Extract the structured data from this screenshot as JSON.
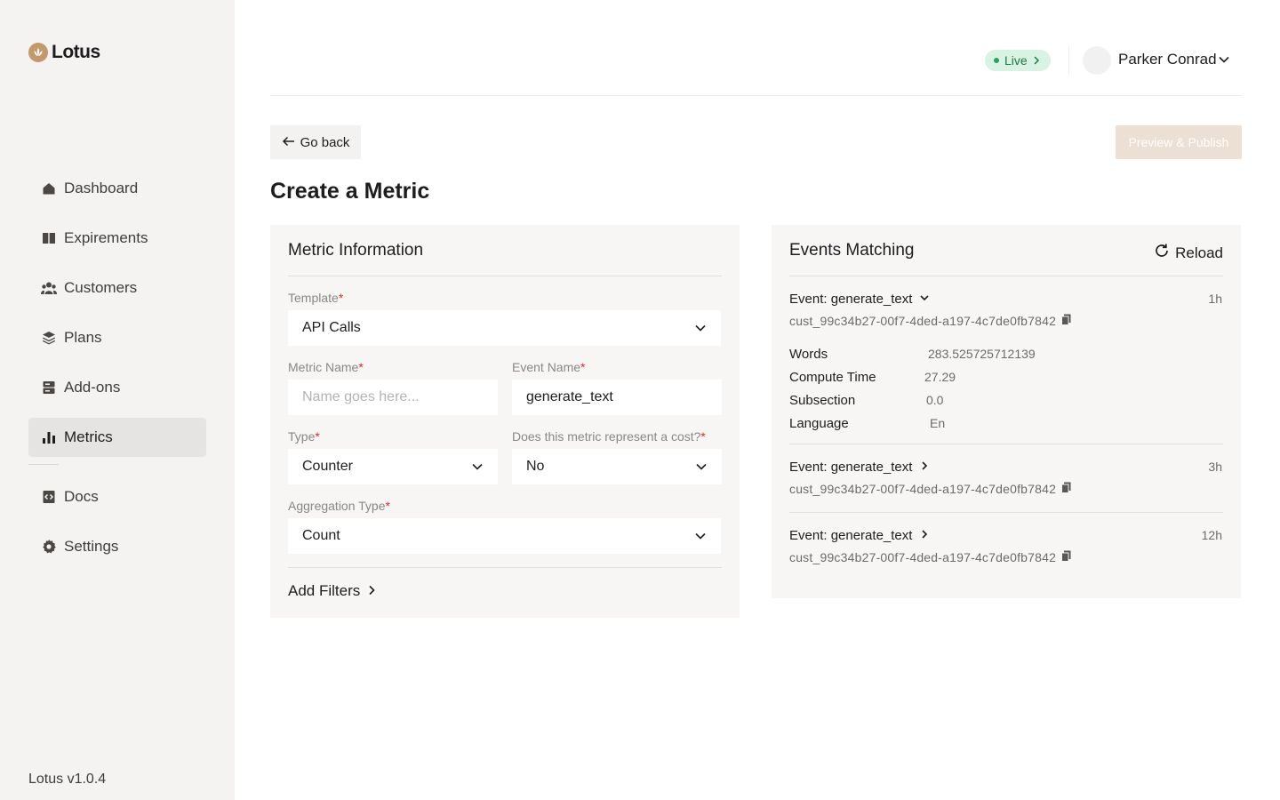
{
  "app": {
    "name": "Lotus",
    "version": "Lotus v1.0.4"
  },
  "sidebar": {
    "items": [
      {
        "label": "Dashboard",
        "icon": "home-icon",
        "active": false
      },
      {
        "label": "Expirements",
        "icon": "book-icon",
        "active": false
      },
      {
        "label": "Customers",
        "icon": "users-icon",
        "active": false
      },
      {
        "label": "Plans",
        "icon": "layers-icon",
        "active": false
      },
      {
        "label": "Add-ons",
        "icon": "server-icon",
        "active": false
      },
      {
        "label": "Metrics",
        "icon": "bar-chart-icon",
        "active": true
      },
      {
        "label": "Docs",
        "icon": "code-file-icon",
        "active": false
      },
      {
        "label": "Settings",
        "icon": "gear-icon",
        "active": false
      }
    ]
  },
  "header": {
    "environment": "Live",
    "user_name": "Parker Conrad"
  },
  "actions": {
    "go_back": "Go back",
    "publish": "Preview & Publish"
  },
  "page": {
    "title": "Create a Metric"
  },
  "metric_form": {
    "title": "Metric Information",
    "template": {
      "label": "Template",
      "value": "API Calls"
    },
    "metric_name": {
      "label": "Metric Name",
      "placeholder": "Name goes here..."
    },
    "event_name": {
      "label": "Event Name",
      "value": "generate_text"
    },
    "type": {
      "label": "Type",
      "value": "Counter"
    },
    "is_cost": {
      "label": "Does this metric represent a cost?",
      "value": "No"
    },
    "aggregation": {
      "label": "Aggregation Type",
      "value": "Count"
    },
    "add_filters": "Add Filters",
    "required_mark": "*"
  },
  "events_panel": {
    "title": "Events Matching",
    "reload": "Reload",
    "events": [
      {
        "name": "Event: generate_text",
        "customer": "cust_99c34b27-00f7-4ded-a197-4c7de0fb7842",
        "time": "1h",
        "expanded": true,
        "properties": [
          {
            "key": "Words",
            "value": "283.525725712139"
          },
          {
            "key": "Compute Time",
            "value": "27.29"
          },
          {
            "key": "Subsection",
            "value": "0.0"
          },
          {
            "key": "Language",
            "value": "En"
          }
        ]
      },
      {
        "name": "Event: generate_text",
        "customer": "cust_99c34b27-00f7-4ded-a197-4c7de0fb7842",
        "time": "3h",
        "expanded": false
      },
      {
        "name": "Event: generate_text",
        "customer": "cust_99c34b27-00f7-4ded-a197-4c7de0fb7842",
        "time": "12h",
        "expanded": false
      }
    ]
  },
  "colors": {
    "sidebar_bg": "#f4f3f2",
    "accent": "#c3986b",
    "live_badge_bg": "#d8f2e3",
    "live_text": "#1c7a45",
    "publish_disabled": "#ecdfd3",
    "required": "#d4312c"
  }
}
